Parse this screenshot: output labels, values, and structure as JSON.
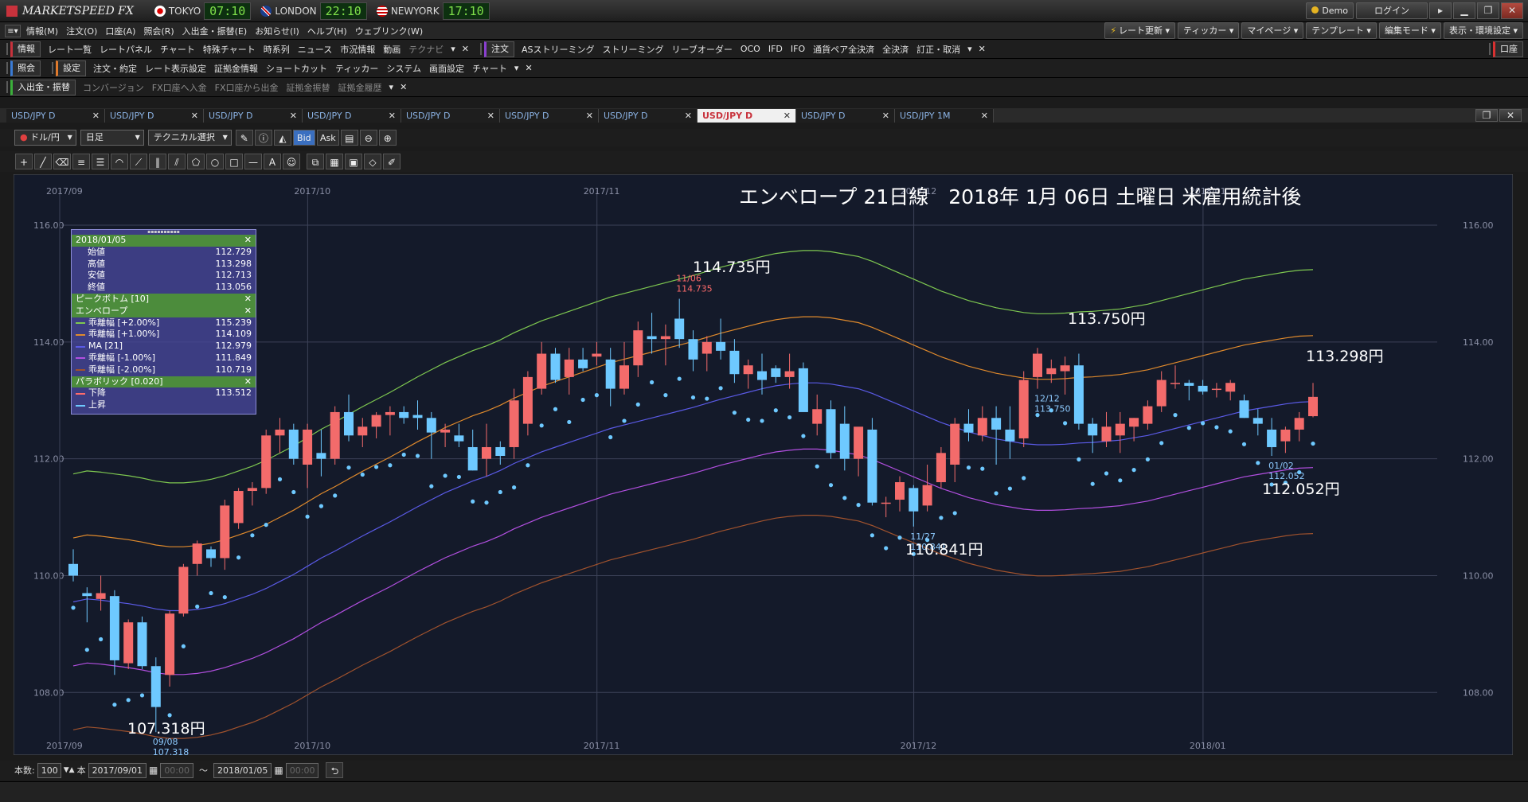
{
  "titlebar": {
    "logo": "MARKETSPEED FX",
    "clocks": [
      {
        "city": "TOKYO",
        "time": "07:10"
      },
      {
        "city": "LONDON",
        "time": "22:10"
      },
      {
        "city": "NEWYORK",
        "time": "17:10"
      }
    ],
    "demo": "Demo",
    "login": "ログイン"
  },
  "menubar": {
    "items": [
      "情報(M)",
      "注文(O)",
      "口座(A)",
      "照会(R)",
      "入出金・振替(E)",
      "お知らせ(I)",
      "ヘルプ(H)",
      "ウェブリンク(W)"
    ],
    "right": [
      "レート更新",
      "ティッカー",
      "マイページ",
      "テンプレート",
      "編集モード",
      "表示・環境設定"
    ]
  },
  "toolbar1": {
    "section1": "情報",
    "items1": [
      "レート一覧",
      "レートパネル",
      "チャート",
      "特殊チャート",
      "時系列",
      "ニュース",
      "市況情報",
      "動画",
      "テクナビ"
    ],
    "section2": "注文",
    "items2": [
      "ASストリーミング",
      "ストリーミング",
      "リーブオーダー",
      "OCO",
      "IFD",
      "IFO",
      "通貨ペア全決済",
      "全決済",
      "訂正・取消"
    ],
    "right": "口座"
  },
  "toolbar2": {
    "section1": "照会",
    "section2": "設定",
    "items": [
      "注文・約定",
      "レート表示設定",
      "証拠金情報",
      "ショートカット",
      "ティッカー",
      "システム",
      "画面設定",
      "チャート"
    ]
  },
  "toolbar3": {
    "section1": "入出金・振替",
    "items": [
      "コンバージョン",
      "FX口座へ入金",
      "FX口座から出金",
      "証拠金振替",
      "証拠金履歴"
    ]
  },
  "tabs": [
    {
      "label": "USD/JPY D",
      "active": false
    },
    {
      "label": "USD/JPY D",
      "active": false
    },
    {
      "label": "USD/JPY D",
      "active": false
    },
    {
      "label": "USD/JPY D",
      "active": false
    },
    {
      "label": "USD/JPY D",
      "active": false
    },
    {
      "label": "USD/JPY D",
      "active": false
    },
    {
      "label": "USD/JPY D",
      "active": false
    },
    {
      "label": "USD/JPY D",
      "active": true
    },
    {
      "label": "USD/JPY D",
      "active": false
    },
    {
      "label": "USD/JPY 1M",
      "active": false
    }
  ],
  "controls": {
    "pair": "ドル/円",
    "period": "日足",
    "technical": "テクニカル選択",
    "bid": "Bid",
    "ask": "Ask"
  },
  "bottom": {
    "count_label": "本数:",
    "count": "100",
    "unit": "本",
    "from_date": "2017/09/01",
    "from_time": "00:00",
    "tilde": "〜",
    "to_date": "2018/01/05",
    "to_time": "00:00"
  },
  "panel": {
    "date": "2018/01/05",
    "ohlc": [
      {
        "label": "始値",
        "value": "112.729"
      },
      {
        "label": "高値",
        "value": "113.298"
      },
      {
        "label": "安値",
        "value": "112.713"
      },
      {
        "label": "終値",
        "value": "113.056"
      }
    ],
    "peak_bottom": "ピークボトム [10]",
    "envelope": "エンベロープ",
    "env_rows": [
      {
        "label": "乖離幅 [+2.00%]",
        "value": "115.239",
        "color": "#7ec850"
      },
      {
        "label": "乖離幅 [+1.00%]",
        "value": "114.109",
        "color": "#e08a2c"
      },
      {
        "label": "MA [21]",
        "value": "112.979",
        "color": "#5a5ae6"
      },
      {
        "label": "乖離幅 [-1.00%]",
        "value": "111.849",
        "color": "#b24fe0"
      },
      {
        "label": "乖離幅 [-2.00%]",
        "value": "110.719",
        "color": "#a0522d"
      }
    ],
    "parabolic": "パラボリック [0.020]",
    "par_rows": [
      {
        "label": "下降",
        "value": "113.512",
        "color": "#ff6b6b"
      },
      {
        "label": "上昇",
        "value": "",
        "color": "#6ec9ff"
      }
    ]
  },
  "chart_title": "エンベロープ 21日線　2018年 1月 06日 土曜日 米雇用統計後",
  "annotations": {
    "a1": "114.735円",
    "a2": "113.750円",
    "a3": "113.298円",
    "a4": "112.052円",
    "a5": "110.841円",
    "a6": "107.318円"
  },
  "chart_data": {
    "type": "candlestick",
    "title": "エンベロープ 21日線　2018年 1月 06日 土曜日 米雇用統計後",
    "symbol": "USD/JPY",
    "timeframe": "日足",
    "ylim": [
      107.2,
      116.6
    ],
    "yticks": [
      "116.00",
      "114.00",
      "112.00",
      "110.00",
      "108.00"
    ],
    "xticks": [
      "2017/09",
      "2017/10",
      "2017/11",
      "2017/12",
      "2018/01"
    ],
    "grid": true,
    "candles": [
      [
        110.2,
        110.45,
        109.9,
        110.0
      ],
      [
        109.7,
        109.8,
        109.2,
        109.65
      ],
      [
        109.6,
        110.0,
        109.4,
        109.7
      ],
      [
        109.65,
        109.75,
        108.3,
        108.55
      ],
      [
        108.5,
        109.25,
        108.4,
        109.2
      ],
      [
        109.2,
        109.3,
        108.4,
        108.45
      ],
      [
        108.45,
        108.6,
        107.32,
        107.75
      ],
      [
        108.3,
        109.4,
        108.1,
        109.35
      ],
      [
        109.35,
        110.2,
        109.3,
        110.15
      ],
      [
        110.2,
        110.6,
        110.0,
        110.55
      ],
      [
        110.45,
        110.5,
        110.15,
        110.3
      ],
      [
        110.3,
        111.3,
        110.1,
        111.2
      ],
      [
        110.9,
        111.5,
        110.8,
        111.45
      ],
      [
        111.45,
        111.6,
        111.2,
        111.5
      ],
      [
        111.5,
        112.5,
        111.4,
        112.4
      ],
      [
        112.4,
        112.7,
        112.1,
        112.5
      ],
      [
        112.5,
        112.6,
        111.9,
        112.0
      ],
      [
        111.9,
        112.6,
        111.5,
        112.5
      ],
      [
        112.1,
        112.5,
        111.7,
        112.0
      ],
      [
        112.0,
        112.9,
        111.9,
        112.8
      ],
      [
        112.8,
        113.1,
        112.3,
        112.4
      ],
      [
        112.4,
        112.7,
        112.2,
        112.55
      ],
      [
        112.55,
        112.8,
        112.35,
        112.75
      ],
      [
        112.75,
        112.9,
        112.4,
        112.8
      ],
      [
        112.8,
        112.9,
        112.6,
        112.7
      ],
      [
        112.75,
        113.0,
        112.5,
        112.7
      ],
      [
        112.7,
        112.8,
        112.0,
        112.45
      ],
      [
        112.45,
        112.6,
        112.2,
        112.5
      ],
      [
        112.4,
        112.6,
        112.2,
        112.3
      ],
      [
        112.2,
        112.5,
        111.8,
        111.8
      ],
      [
        112.0,
        112.6,
        111.7,
        112.2
      ],
      [
        112.2,
        112.3,
        111.9,
        112.05
      ],
      [
        112.2,
        113.2,
        112.0,
        113.0
      ],
      [
        112.6,
        113.5,
        112.4,
        113.4
      ],
      [
        113.2,
        114.0,
        113.1,
        113.8
      ],
      [
        113.8,
        113.9,
        113.3,
        113.35
      ],
      [
        113.4,
        113.9,
        113.1,
        113.7
      ],
      [
        113.7,
        113.9,
        113.5,
        113.55
      ],
      [
        113.75,
        114.0,
        113.6,
        113.8
      ],
      [
        113.7,
        113.9,
        112.9,
        113.2
      ],
      [
        113.2,
        114.0,
        113.1,
        113.6
      ],
      [
        113.6,
        114.35,
        113.4,
        114.2
      ],
      [
        114.1,
        114.5,
        113.8,
        114.05
      ],
      [
        114.05,
        114.3,
        113.6,
        114.1
      ],
      [
        114.4,
        114.74,
        113.9,
        114.05
      ],
      [
        114.05,
        114.2,
        113.5,
        113.7
      ],
      [
        113.8,
        114.1,
        113.5,
        114.0
      ],
      [
        114.0,
        114.4,
        113.7,
        113.85
      ],
      [
        113.85,
        114.05,
        113.3,
        113.45
      ],
      [
        113.45,
        113.7,
        113.2,
        113.6
      ],
      [
        113.5,
        113.8,
        113.1,
        113.35
      ],
      [
        113.55,
        113.6,
        113.3,
        113.4
      ],
      [
        113.4,
        113.8,
        113.2,
        113.5
      ],
      [
        113.55,
        113.65,
        112.9,
        112.8
      ],
      [
        112.6,
        113.1,
        112.4,
        112.85
      ],
      [
        112.85,
        113.0,
        112.0,
        112.1
      ],
      [
        112.6,
        112.9,
        111.8,
        112.0
      ],
      [
        112.0,
        112.5,
        111.7,
        112.55
      ],
      [
        112.5,
        112.7,
        111.2,
        111.25
      ],
      [
        111.25,
        111.35,
        111.0,
        111.25
      ],
      [
        111.3,
        111.7,
        111.1,
        111.6
      ],
      [
        111.5,
        111.55,
        110.84,
        111.1
      ],
      [
        111.2,
        111.9,
        111.1,
        111.55
      ],
      [
        111.6,
        112.2,
        111.5,
        112.1
      ],
      [
        111.9,
        112.7,
        111.6,
        112.6
      ],
      [
        112.6,
        112.85,
        112.3,
        112.45
      ],
      [
        112.4,
        112.9,
        112.3,
        112.7
      ],
      [
        112.7,
        112.9,
        111.9,
        112.5
      ],
      [
        112.5,
        112.9,
        112.0,
        112.3
      ],
      [
        112.35,
        113.5,
        112.2,
        113.35
      ],
      [
        113.4,
        113.9,
        113.2,
        113.8
      ],
      [
        113.45,
        113.7,
        113.3,
        113.55
      ],
      [
        113.5,
        113.75,
        113.1,
        113.6
      ],
      [
        113.6,
        113.8,
        112.5,
        112.6
      ],
      [
        112.6,
        112.7,
        112.1,
        112.4
      ],
      [
        112.3,
        112.8,
        112.2,
        112.55
      ],
      [
        112.4,
        112.8,
        112.1,
        112.6
      ],
      [
        112.55,
        112.7,
        112.3,
        112.7
      ],
      [
        112.6,
        113.0,
        112.5,
        112.9
      ],
      [
        112.9,
        113.5,
        112.8,
        113.35
      ],
      [
        113.3,
        113.6,
        113.2,
        113.3
      ],
      [
        113.3,
        113.35,
        113.0,
        113.25
      ],
      [
        113.25,
        113.35,
        113.1,
        113.15
      ],
      [
        113.2,
        113.3,
        113.05,
        113.2
      ],
      [
        113.15,
        113.35,
        113.0,
        113.3
      ],
      [
        113.0,
        113.1,
        112.7,
        112.7
      ],
      [
        112.7,
        112.85,
        112.4,
        112.6
      ],
      [
        112.5,
        112.7,
        112.05,
        112.2
      ],
      [
        112.3,
        112.55,
        112.1,
        112.5
      ],
      [
        112.5,
        112.8,
        112.3,
        112.7
      ],
      [
        112.73,
        113.3,
        112.71,
        113.06
      ]
    ],
    "candle_format": [
      "open",
      "high",
      "low",
      "close"
    ],
    "envelope_ma21": [
      109.55,
      109.6,
      109.58,
      109.55,
      109.52,
      109.48,
      109.43,
      109.4,
      109.4,
      109.42,
      109.46,
      109.52,
      109.6,
      109.68,
      109.78,
      109.9,
      110.02,
      110.16,
      110.3,
      110.42,
      110.55,
      110.68,
      110.8,
      110.92,
      111.05,
      111.18,
      111.3,
      111.42,
      111.52,
      111.62,
      111.7,
      111.8,
      111.92,
      112.02,
      112.12,
      112.2,
      112.28,
      112.36,
      112.44,
      112.52,
      112.58,
      112.64,
      112.7,
      112.76,
      112.82,
      112.88,
      112.95,
      113.02,
      113.08,
      113.14,
      113.2,
      113.25,
      113.28,
      113.3,
      113.3,
      113.28,
      113.24,
      113.2,
      113.12,
      113.02,
      112.92,
      112.82,
      112.72,
      112.62,
      112.54,
      112.46,
      112.4,
      112.34,
      112.3,
      112.26,
      112.24,
      112.24,
      112.25,
      112.27,
      112.28,
      112.3,
      112.32,
      112.36,
      112.4,
      112.46,
      112.52,
      112.58,
      112.64,
      112.7,
      112.76,
      112.82,
      112.86,
      112.9,
      112.94,
      112.97,
      112.98
    ],
    "parabolic_down_visible": true,
    "parabolic_up_visible": true,
    "price_labels": [
      {
        "date": "09/08",
        "price": "107.318",
        "candle": 6
      },
      {
        "date": "11/06",
        "price": "114.735",
        "candle": 44
      },
      {
        "date": "11/27",
        "price": "110.841",
        "candle": 61
      },
      {
        "date": "12/12",
        "price": "113.750",
        "candle": 70
      },
      {
        "date": "01/02",
        "price": "112.052",
        "candle": 87
      }
    ],
    "colors": {
      "up": "#f36b6b",
      "down": "#6ec9ff",
      "bg": "#141a2a",
      "grid": "#3c4258"
    }
  }
}
